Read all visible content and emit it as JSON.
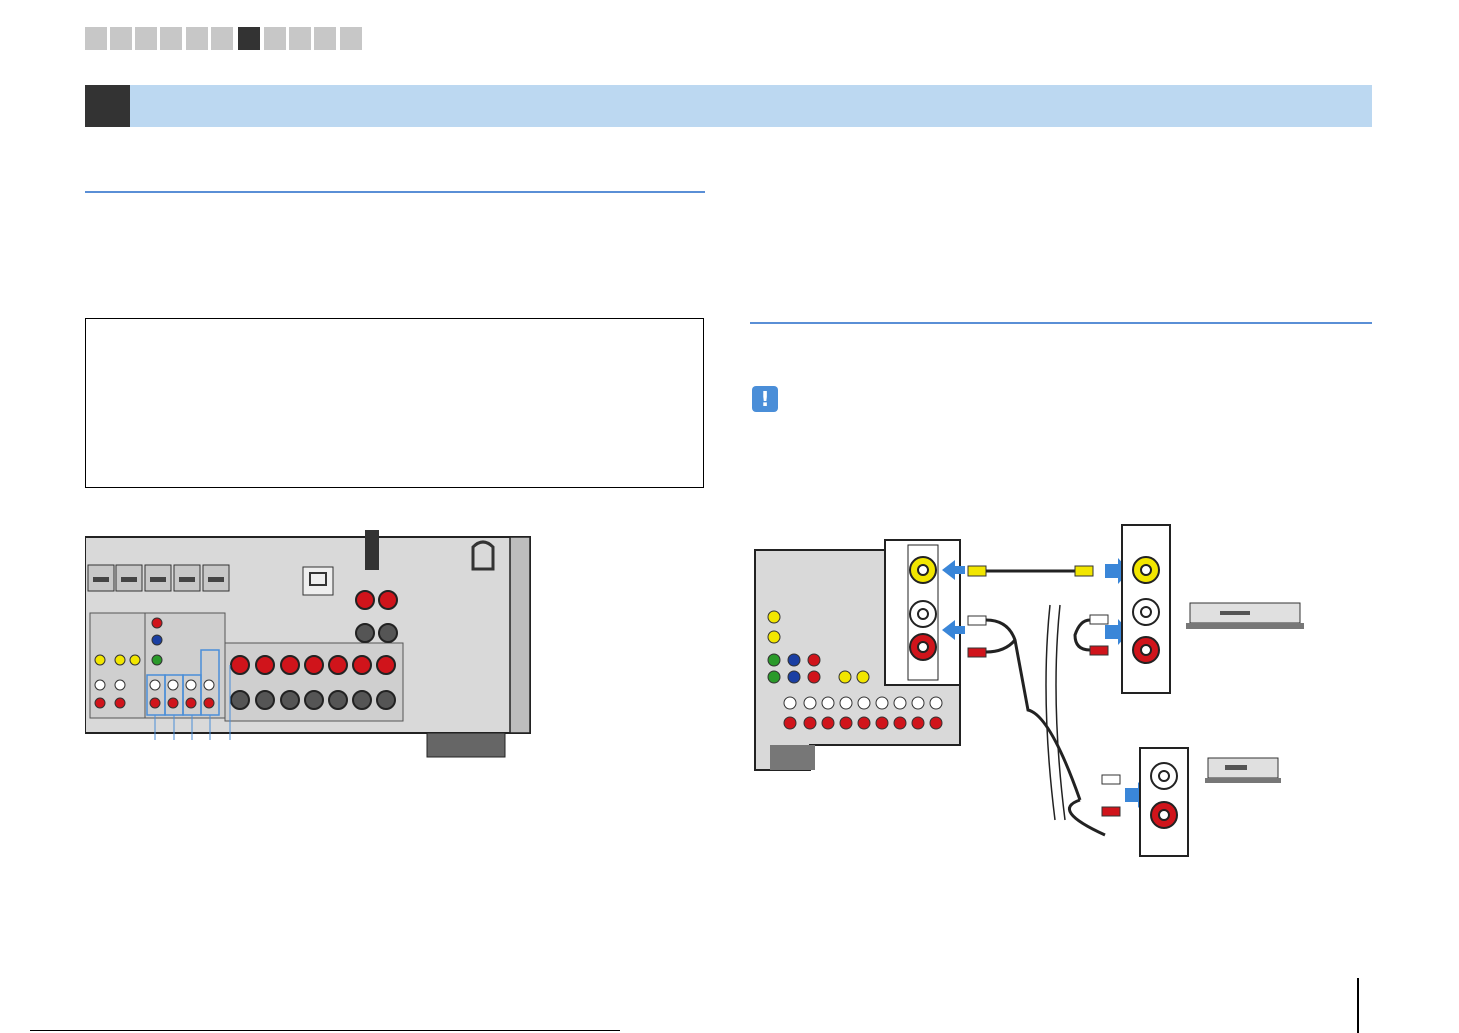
{
  "page": {
    "section_tabs": [
      {
        "active": false
      },
      {
        "active": false
      },
      {
        "active": false
      },
      {
        "active": false
      },
      {
        "active": false
      },
      {
        "active": false
      },
      {
        "active": true
      },
      {
        "active": false
      },
      {
        "active": false
      },
      {
        "active": false
      },
      {
        "active": false
      }
    ],
    "chapter_title": "",
    "page_number": "",
    "footer_text": ""
  },
  "icons": {
    "caution": "caution-icon",
    "caution_glyph": "!"
  },
  "colors": {
    "chapter_bar": "#bcd8f1",
    "accent_rule": "#5a8fd6",
    "video_jack": "#f2e600",
    "audio_left": "#ffffff",
    "audio_right": "#d0141b",
    "arrow": "#3a86d8"
  }
}
